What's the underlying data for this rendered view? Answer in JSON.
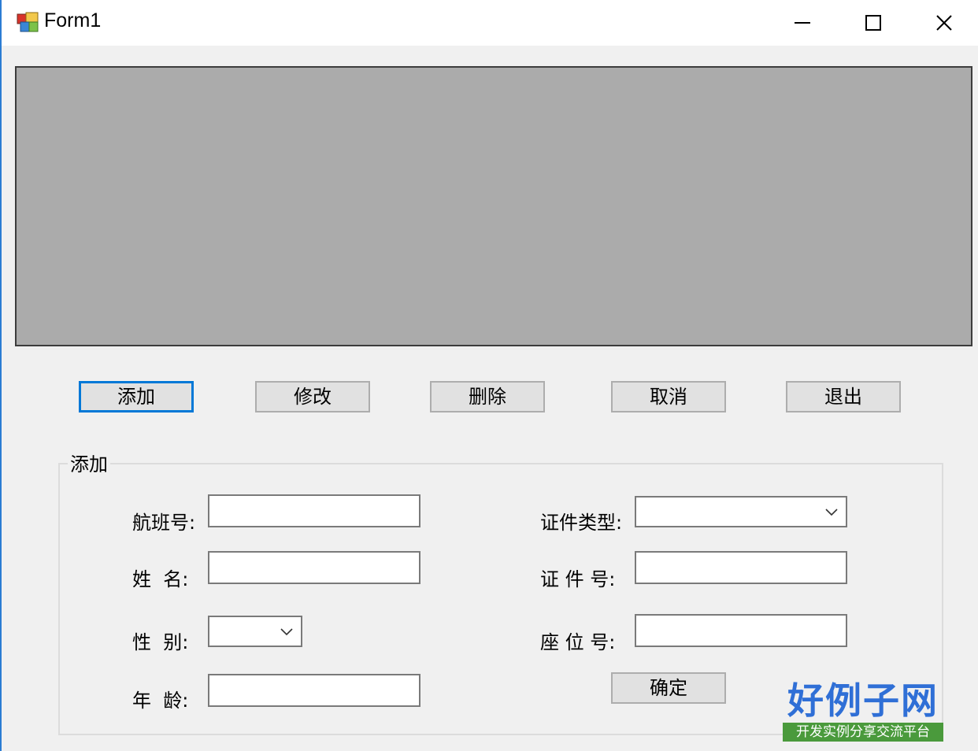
{
  "window": {
    "title": "Form1"
  },
  "buttons": {
    "add": "添加",
    "modify": "修改",
    "delete": "删除",
    "cancel": "取消",
    "exit": "退出",
    "confirm": "确定"
  },
  "groupbox": {
    "title": "添加"
  },
  "fields": {
    "flight_no": {
      "label": "航班号:",
      "value": ""
    },
    "name": {
      "label": "姓  名:",
      "value": ""
    },
    "gender": {
      "label": "性  别:",
      "value": ""
    },
    "age": {
      "label": "年  龄:",
      "value": ""
    },
    "id_type": {
      "label": "证件类型:",
      "value": ""
    },
    "id_no": {
      "label": "证 件 号:",
      "value": ""
    },
    "seat_no": {
      "label": "座 位 号:",
      "value": ""
    }
  },
  "watermark": {
    "title": "好例子网",
    "subtitle": "开发实例分享交流平台"
  },
  "colors": {
    "focus_border": "#0078d7",
    "grid_background": "#ababab",
    "form_background": "#f0f0f0"
  },
  "icons": {
    "app": "form-app-icon",
    "minimize": "minimize-icon",
    "maximize": "maximize-icon",
    "close": "close-icon",
    "dropdown": "chevron-down-icon"
  }
}
